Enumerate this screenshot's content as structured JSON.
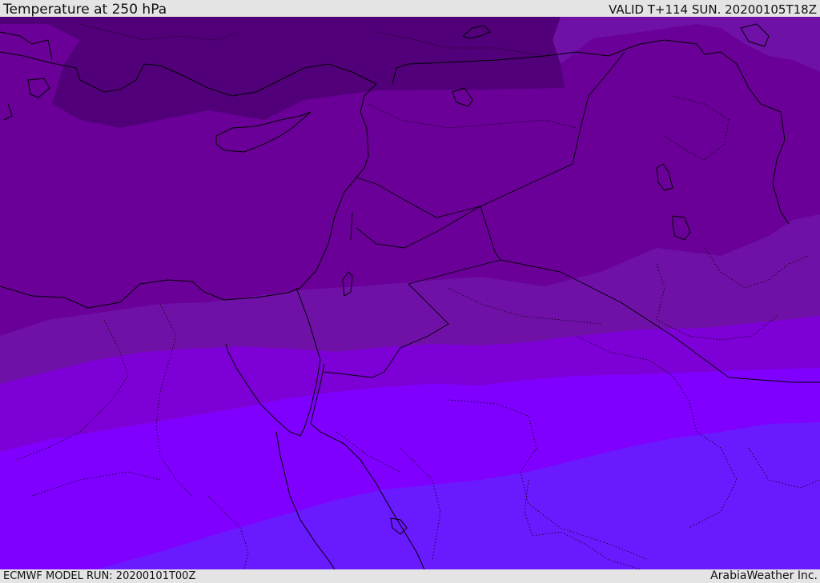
{
  "header": {
    "title": "Temperature at 250 hPa",
    "valid_time": "VALID T+114 SUN. 20200105T18Z"
  },
  "footer": {
    "model_run": "ECMWF MODEL RUN: 20200101T00Z",
    "credit": "ArabiaWeather Inc."
  },
  "map": {
    "variable": "temperature",
    "level": "250 hPa",
    "band_colors": [
      "#52007a",
      "#62008f",
      "#6f11a6",
      "#7d00d7",
      "#8000ff",
      "#6a1aff"
    ],
    "coastline_color": "#000000",
    "border_style": "dotted"
  }
}
